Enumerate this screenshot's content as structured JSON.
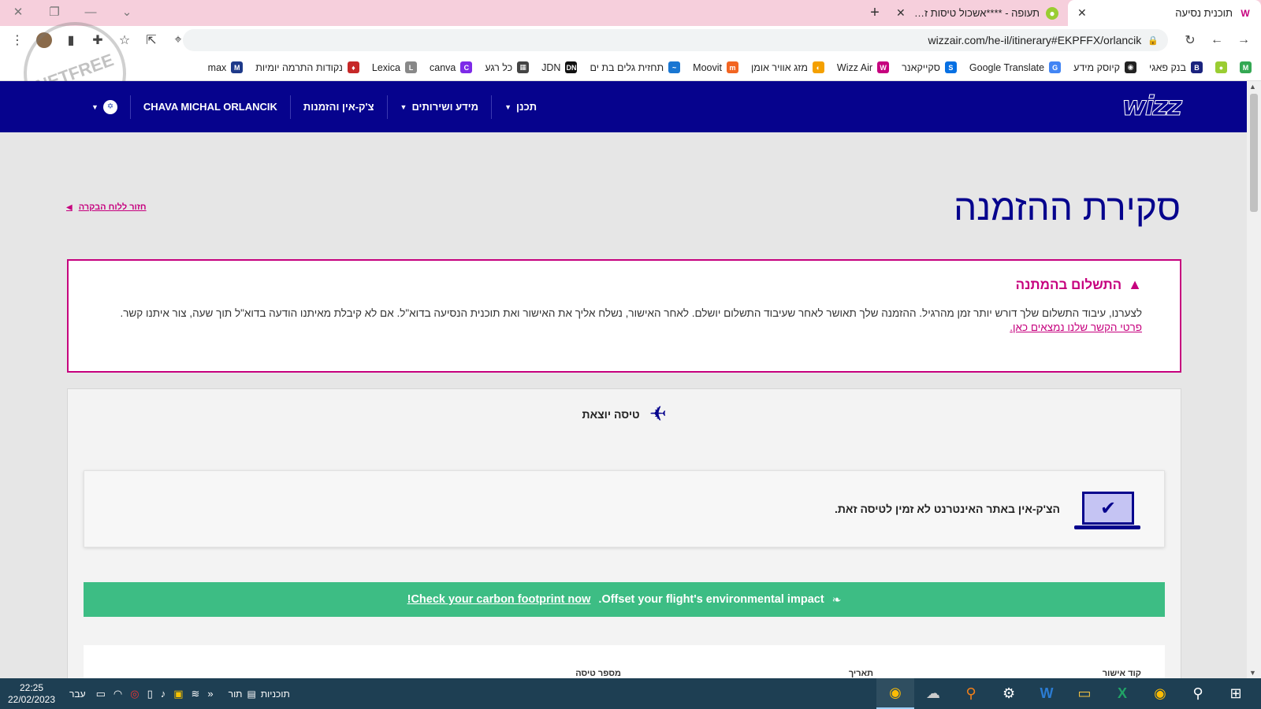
{
  "browser": {
    "tabs": [
      {
        "title": "תוכנית נסיעה",
        "active": true
      },
      {
        "title": "תעופה - ****אשכול טיסות זולות!!",
        "active": false
      }
    ],
    "address": "wizzair.com/he-il/itinerary#EKPFFX/orlancik",
    "bookmarks": [
      {
        "label": "",
        "color": "#34a853",
        "glyph": "M"
      },
      {
        "label": "",
        "color": "#9acd32",
        "glyph": "●"
      },
      {
        "label": "בנק פאגי",
        "color": "#1a237e",
        "glyph": "B"
      },
      {
        "label": "קיוסק מידע",
        "color": "#222222",
        "glyph": "◉"
      },
      {
        "label": "Google Translate",
        "color": "#4285f4",
        "glyph": "G"
      },
      {
        "label": "סקייקאנר",
        "color": "#0770e3",
        "glyph": "S"
      },
      {
        "label": "Wizz Air",
        "color": "#c6007e",
        "glyph": "W"
      },
      {
        "label": "מזג אוויר אומן",
        "color": "#f4a000",
        "glyph": "◐"
      },
      {
        "label": "Moovit",
        "color": "#f26522",
        "glyph": "m"
      },
      {
        "label": "תחזית גלים בת ים",
        "color": "#1976d2",
        "glyph": "~"
      },
      {
        "label": "JDN",
        "color": "#111111",
        "glyph": "DN"
      },
      {
        "label": "כל רגע",
        "color": "#444444",
        "glyph": "▦"
      },
      {
        "label": "canva",
        "color": "#7d2ae8",
        "glyph": "C"
      },
      {
        "label": "Lexica",
        "color": "#888888",
        "glyph": "L"
      },
      {
        "label": "נקודות התרמה יומיות",
        "color": "#c62828",
        "glyph": "♦"
      },
      {
        "label": "max",
        "color": "#1e3a8a",
        "glyph": "M"
      }
    ]
  },
  "site": {
    "nav": {
      "plan": "תכנן",
      "info": "מידע ושירותים",
      "checkin": "צ'ק-אין והזמנות",
      "user": "CHAVA MICHAL ORLANCIK"
    },
    "logo_text": "wizz"
  },
  "page": {
    "title": "סקירת ההזמנה",
    "back_link": "חזור ללוח הבקרה",
    "alert": {
      "heading": "התשלום בהמתנה",
      "body": "לצערנו, עיבוד התשלום שלך דורש יותר זמן מהרגיל. ההזמנה שלך תאושר לאחר שעיבוד התשלום יושלם. לאחר האישור, נשלח אליך את האישור ואת תוכנית הנסיעה בדוא\"ל. אם לא קיבלת מאיתנו הודעה בדוא\"ל תוך שעה, צור איתנו קשר.",
      "link": "פרטי הקשר שלנו נמצאים כאן."
    },
    "flight": {
      "heading": "טיסה יוצאת",
      "checkin_msg": "הצ'ק-אין באתר האינטרנט לא זמין לטיסה זאת.",
      "carbon_text": "Offset your flight's environmental impact.",
      "carbon_link": "Check your carbon footprint now!",
      "columns": [
        "קוד אישור",
        "תאריך",
        "מספר טיסה"
      ]
    }
  },
  "taskbar": {
    "time": "22:25",
    "date": "22/02/2023",
    "lang": "עבר",
    "program_label": "תוכניות",
    "program_short": "תור"
  },
  "colors": {
    "brand_blue": "#06038d",
    "brand_magenta": "#c6007e",
    "carbon_green": "#3dbd84"
  }
}
